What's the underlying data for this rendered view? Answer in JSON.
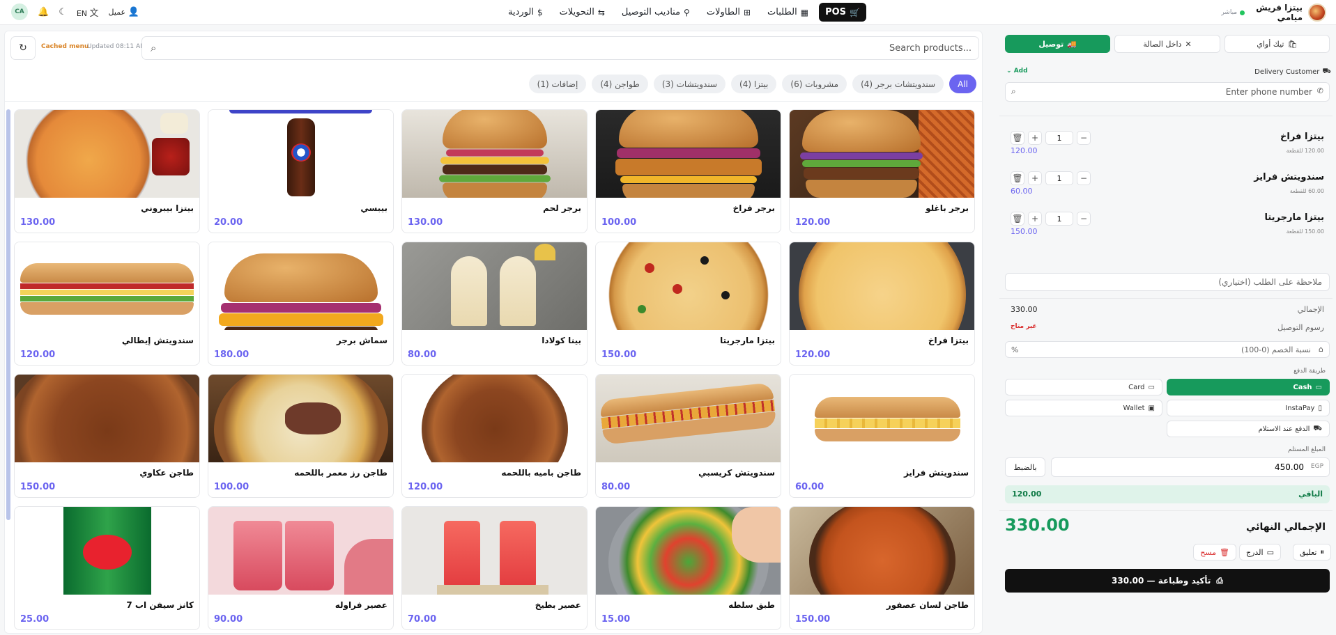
{
  "header": {
    "brand_line1": "بيتزا فريش",
    "brand_line2": "ميامي",
    "live_status": "مباشر",
    "nav": [
      {
        "label": "POS",
        "icon": "cart-icon",
        "active": true
      },
      {
        "label": "الطلبات",
        "icon": "grid-icon"
      },
      {
        "label": "الطاولات",
        "icon": "table-icon"
      },
      {
        "label": "مناديب التوصيل",
        "icon": "bike-icon"
      },
      {
        "label": "التحويلات",
        "icon": "transfer-icon"
      },
      {
        "label": "الوردية",
        "icon": "dollar-icon"
      }
    ],
    "customer_label": "عميل",
    "language": "EN",
    "avatar_initials": "CA"
  },
  "products_panel": {
    "cache_status": "Cached menu",
    "updated_text": "Updated 08:11 AM",
    "search_placeholder": "Search products...",
    "categories": [
      {
        "label": "All",
        "active": true
      },
      {
        "label": "سندويتشات برجر (4)"
      },
      {
        "label": "مشروبات (6)"
      },
      {
        "label": "بيتزا (4)"
      },
      {
        "label": "سندويتشات (3)"
      },
      {
        "label": "طواجن (4)"
      },
      {
        "label": "إضافات (1)"
      }
    ],
    "products": [
      {
        "name": "برجر باغلو",
        "price": "120.00",
        "image": "burger-loaded"
      },
      {
        "name": "برجر فراخ",
        "price": "100.00",
        "image": "burger-chicken"
      },
      {
        "name": "برجر لحم",
        "price": "130.00",
        "image": "burger-beef"
      },
      {
        "name": "بيبسي",
        "price": "20.00",
        "image": "pepsi-bottle"
      },
      {
        "name": "بيتزا بيبروني",
        "price": "130.00",
        "image": "pizza-pepperoni"
      },
      {
        "name": "بيتزا فراخ",
        "price": "120.00",
        "image": "pizza-chicken"
      },
      {
        "name": "بيتزا مارجريتا",
        "price": "150.00",
        "image": "pizza-margherita"
      },
      {
        "name": "بينا كولادا",
        "price": "80.00",
        "image": "pina-colada"
      },
      {
        "name": "سماش برجر",
        "price": "180.00",
        "image": "smash-burger"
      },
      {
        "name": "سندويتش إيطالي",
        "price": "120.00",
        "image": "italian-sub"
      },
      {
        "name": "سندويتش فرايز",
        "price": "60.00",
        "image": "fries-sandwich"
      },
      {
        "name": "سندويتش كريسبي",
        "price": "80.00",
        "image": "crispy-sandwich"
      },
      {
        "name": "طاجن باميه باللحمه",
        "price": "120.00",
        "image": "okra-tagine"
      },
      {
        "name": "طاجن رز معمر باللحمه",
        "price": "100.00",
        "image": "rice-tagine"
      },
      {
        "name": "طاجن عكاوي",
        "price": "150.00",
        "image": "oxtail-tagine"
      },
      {
        "name": "طاجن لسان عصفور",
        "price": "150.00",
        "image": "orzo-tagine"
      },
      {
        "name": "طبق سلطه",
        "price": "15.00",
        "image": "salad"
      },
      {
        "name": "عصير بطيخ",
        "price": "70.00",
        "image": "watermelon-juice"
      },
      {
        "name": "عصير فراوله",
        "price": "90.00",
        "image": "strawberry-juice"
      },
      {
        "name": "كانز سيفن اب 7",
        "price": "25.00",
        "image": "7up-can"
      }
    ]
  },
  "order_panel": {
    "order_types": [
      {
        "label": "توصيل",
        "icon": "truck-icon",
        "active": true
      },
      {
        "label": "داخل الصالة",
        "icon": "utensils-icon"
      },
      {
        "label": "تيك أواي",
        "icon": "bag-icon"
      }
    ],
    "delivery_customer_label": "Delivery Customer",
    "add_label": "Add",
    "phone_placeholder": "Enter phone number",
    "items": [
      {
        "name": "بيتزا فراخ",
        "unit_price": "120.00 للقطعة",
        "qty": "1",
        "total": "120.00"
      },
      {
        "name": "سندويتش فرايز",
        "unit_price": "60.00 للقطعة",
        "qty": "1",
        "total": "60.00"
      },
      {
        "name": "بيتزا مارجريتا",
        "unit_price": "150.00 للقطعة",
        "qty": "1",
        "total": "150.00"
      }
    ],
    "note_placeholder": "ملاحظة على الطلب (اختياري)",
    "subtotal_label": "الإجمالي",
    "subtotal_value": "330.00",
    "delivery_fee_label": "رسوم التوصيل",
    "delivery_fee_value": "غير متاح",
    "discount_placeholder": "نسبة الخصم (0-100)",
    "discount_unit": "%",
    "payment_method_label": "طريقة الدفع",
    "payment_methods": [
      {
        "label": "Cash",
        "icon": "cash-icon",
        "active": true
      },
      {
        "label": "Card",
        "icon": "card-icon"
      },
      {
        "label": "InstaPay",
        "icon": "phone-icon"
      },
      {
        "label": "Wallet",
        "icon": "wallet-icon"
      },
      {
        "label": "الدفع عند الاستلام",
        "icon": "truck-icon"
      }
    ],
    "received_label": "المبلغ المستلم",
    "received_value": "450.00",
    "currency": "EGP",
    "exact_label": "بالضبط",
    "remaining_label": "الباقي",
    "remaining_value": "120.00",
    "grand_total_label": "الإجمالي النهائي",
    "grand_total_value": "330.00",
    "actions": {
      "hold": "تعليق",
      "drawer": "الدرج",
      "clear": "مسح"
    },
    "confirm_label": "تأكيد وطباعة — 330.00"
  },
  "colors": {
    "accent": "#6b64f0",
    "primary_green": "#179a5c",
    "danger": "#d92c2c"
  }
}
